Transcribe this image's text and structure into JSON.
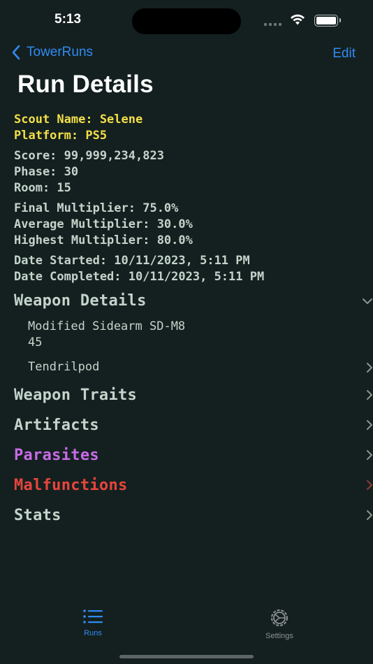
{
  "status_bar": {
    "time": "5:13"
  },
  "nav": {
    "back_label": "TowerRuns",
    "edit_label": "Edit",
    "title": "Run Details"
  },
  "info": {
    "scout_name": "Scout Name: Selene",
    "platform": "Platform: PS5",
    "score": "Score: 99,999,234,823",
    "phase": "Phase: 30",
    "room": "Room: 15",
    "final_multiplier": "Final Multiplier: 75.0%",
    "average_multiplier": "Average Multiplier: 30.0%",
    "highest_multiplier": "Highest Multiplier: 80.0%",
    "date_started": "Date Started: 10/11/2023, 5:11 PM",
    "date_completed": "Date Completed: 10/11/2023, 5:11 PM"
  },
  "sections": {
    "weapon_details": {
      "title": "Weapon Details",
      "items": [
        {
          "name": "Modified Sidearm SD-M8",
          "value": "45"
        },
        {
          "name": "Tendrilpod"
        }
      ]
    },
    "weapon_traits": {
      "title": "Weapon Traits"
    },
    "artifacts": {
      "title": "Artifacts"
    },
    "parasites": {
      "title": "Parasites",
      "color": "#c86be8"
    },
    "malfunctions": {
      "title": "Malfunctions",
      "color": "#e8453c"
    },
    "stats": {
      "title": "Stats"
    }
  },
  "tab_bar": {
    "runs_label": "Runs",
    "settings_label": "Settings",
    "active_color": "#2f8bf3",
    "inactive_color": "#8c9392",
    "icons": [
      "list-icon",
      "gear-icon"
    ]
  },
  "colors": {
    "background": "#14201f",
    "text": "#c4d4cc",
    "yellow": "#f3df49",
    "accent": "#2f8bf3"
  }
}
